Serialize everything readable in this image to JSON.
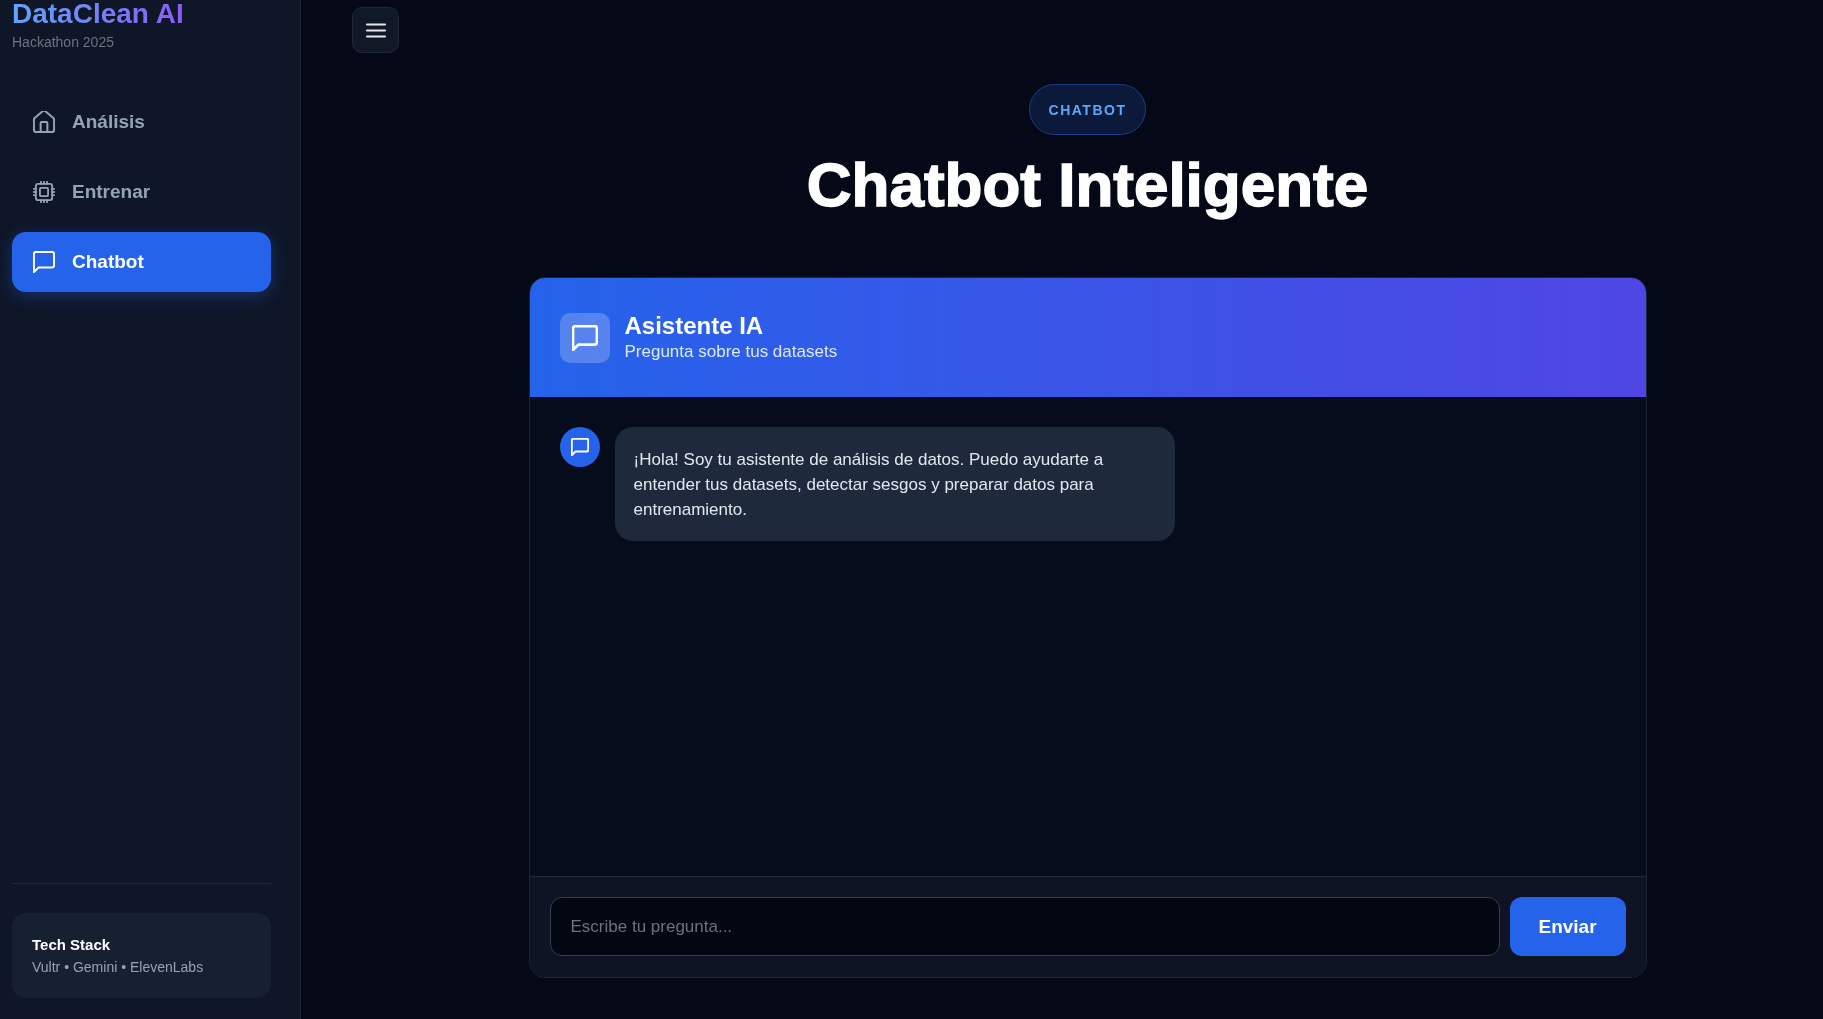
{
  "sidebar": {
    "logo": "DataClean AI",
    "subtitle": "Hackathon 2025",
    "nav": [
      {
        "label": "Análisis",
        "selected": false
      },
      {
        "label": "Entrenar",
        "selected": false
      },
      {
        "label": "Chatbot",
        "selected": true
      }
    ],
    "tech_stack": {
      "title": "Tech Stack",
      "items": "Vultr • Gemini • ElevenLabs"
    }
  },
  "header": {
    "badge": "CHATBOT",
    "title": "Chatbot Inteligente"
  },
  "chat": {
    "title": "Asistente IA",
    "subtitle": "Pregunta sobre tus datasets",
    "messages": [
      {
        "kind": "assistant",
        "text": "¡Hola! Soy tu asistente de análisis de datos. Puedo ayudarte a entender tus datasets, detectar sesgos y preparar datos para entrenamiento."
      }
    ],
    "input": {
      "placeholder": "Escribe tu pregunta..."
    },
    "send_button": "Enviar"
  }
}
